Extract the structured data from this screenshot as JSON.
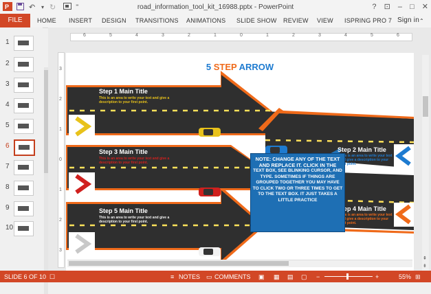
{
  "window": {
    "title": "road_information_tool_kit_16988.pptx - PowerPoint",
    "controls": [
      "?",
      "–",
      "□",
      "✕"
    ]
  },
  "quick_access": [
    "save-icon",
    "undo-icon",
    "redo-icon",
    "start-from-beginning-icon",
    "customize-icon"
  ],
  "ribbon": {
    "file_label": "FILE",
    "tabs": [
      "HOME",
      "INSERT",
      "DESIGN",
      "TRANSITIONS",
      "ANIMATIONS",
      "SLIDE SHOW",
      "REVIEW",
      "VIEW",
      "ISPRING PRO 7"
    ],
    "signin": "Sign in"
  },
  "thumbnails": {
    "numbers": [
      "1",
      "2",
      "3",
      "4",
      "5",
      "6",
      "7",
      "8",
      "9",
      "10"
    ],
    "selected_index": 5
  },
  "ruler": {
    "h_labels": [
      "6",
      "5",
      "4",
      "3",
      "2",
      "1",
      "0",
      "1",
      "2",
      "3",
      "4",
      "5",
      "6"
    ],
    "v_labels": [
      "3",
      "2",
      "1",
      "0",
      "1",
      "2",
      "3"
    ]
  },
  "slide": {
    "title_num": "5",
    "title_step": "STEP",
    "title_arrow": "ARROW",
    "steps": [
      {
        "title": "Step 1 Main Title",
        "desc": "This is an area to write your text and give a description to your first point.",
        "color": "#e8c21a"
      },
      {
        "title": "Step 2 Main Title",
        "desc": "This is an area to write your text and give a description to your first point.",
        "color": "#1e7bd0"
      },
      {
        "title": "Step 3 Main Title",
        "desc": "This is an area to write your text and give a description to your first point.",
        "color": "#d0201e"
      },
      {
        "title": "Step 4 Main Title",
        "desc": "This is an area to write your text and give a description to your first point.",
        "color": "#ef6a1a"
      },
      {
        "title": "Step 5 Main Title",
        "desc": "This is an area to write your text and give a description to your first point.",
        "color": "#c8c8c8"
      }
    ],
    "note_lead": "NOTE: CHANGE ANY OF THE TEXT AND REPLACE IT. CLICK IN THE",
    "note_body": "TEXT BOX, SEE BLINKING CURSOR, AND TYPE. SOMETIMES IF THINGS ARE GROUPED TOGETHER YOU MAY HAVE TO CLICK TWO OR THREE TIMES TO GET TO THE TEXT BOX. IT JUST TAKES A LITTLE PRACTICE"
  },
  "status": {
    "slide_info": "SLIDE 6 OF 10",
    "notes": "NOTES",
    "comments": "COMMENTS",
    "zoom": "55%"
  },
  "colors": {
    "accent": "#d24726",
    "title_blue": "#1e7bd0",
    "road": "#2f2f2f",
    "road_border": "#e0642a"
  }
}
